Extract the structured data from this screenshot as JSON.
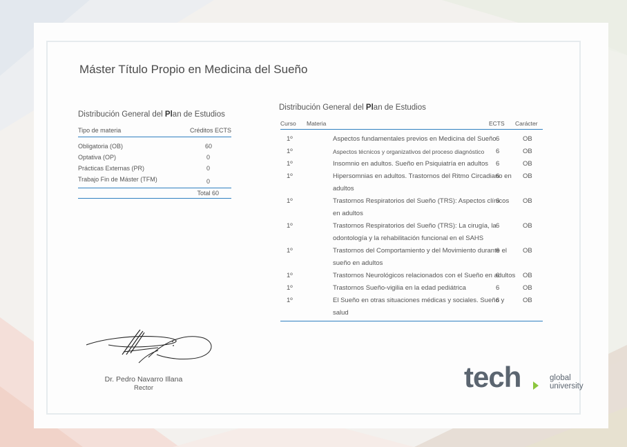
{
  "document": {
    "title": "Máster Título Propio en Medicina del Sueño"
  },
  "summary": {
    "heading_a": "Distribución General del ",
    "heading_b": "Pl",
    "heading_c": "an de Estudios",
    "col_type": "Tipo de materia",
    "col_credits": "Créditos ECTS",
    "rows": [
      {
        "type": "Obligatoria (OB)",
        "credits": "60"
      },
      {
        "type": "Optativa (OP)",
        "credits": "0"
      },
      {
        "type": "Prácticas Externas (PR)",
        "credits": "0"
      },
      {
        "type": "Trabajo Fin de Máster (TFM)",
        "credits": "0"
      }
    ],
    "total": "Total 60"
  },
  "plan": {
    "heading_a": "Distribución General del ",
    "heading_b": "Pl",
    "heading_c": "an de Estudios",
    "col_course": "Curso",
    "col_subject": "Materia",
    "col_ects": "ECTS",
    "col_character": "Carácter",
    "rows": [
      {
        "course": "1º",
        "subject": "Aspectos fundamentales previos en Medicina del Sueño",
        "ects": "6",
        "character": "OB"
      },
      {
        "course": "1º",
        "subject": "Aspectos técnicos y organizativos del proceso diagnóstico",
        "ects": "6",
        "character": "OB"
      },
      {
        "course": "1º",
        "subject": "Insomnio en adultos. Sueño en Psiquiatría en adultos",
        "ects": "6",
        "character": "OB"
      },
      {
        "course": "1º",
        "subject": "Hipersomnias en adultos. Trastornos del Ritmo Circadiano en adultos",
        "ects": "6",
        "character": "OB"
      },
      {
        "course": "1º",
        "subject": "Trastornos Respiratorios del Sueño (TRS): Aspectos clínicos en adultos",
        "ects": "6",
        "character": "OB"
      },
      {
        "course": "1º",
        "subject": "Trastornos Respiratorios del Sueño (TRS): La cirugía, la odontología y la rehabilitación funcional en el SAHS",
        "ects": "6",
        "character": "OB"
      },
      {
        "course": "1º",
        "subject": "Trastornos del Comportamiento y del Movimiento durante el sueño en adultos",
        "ects": "6",
        "character": "OB"
      },
      {
        "course": "1º",
        "subject": "Trastornos Neurológicos relacionados con el Sueño en adultos",
        "ects": "6",
        "character": "OB"
      },
      {
        "course": "1º",
        "subject": "Trastornos Sueño-vigilia en la edad pediátrica",
        "ects": "6",
        "character": "OB"
      },
      {
        "course": "1º",
        "subject": "El Sueño en otras situaciones médicas y sociales. Sueño y salud",
        "ects": "6",
        "character": "OB"
      }
    ]
  },
  "signer": {
    "name": "Dr. Pedro Navarro Illana",
    "role": "Rector"
  },
  "logo": {
    "word": "tech",
    "line1": "global",
    "line2": "university",
    "accent": "#8cc63e",
    "color": "#5b6570"
  },
  "colors": {
    "rule": "#2d7fc0"
  }
}
